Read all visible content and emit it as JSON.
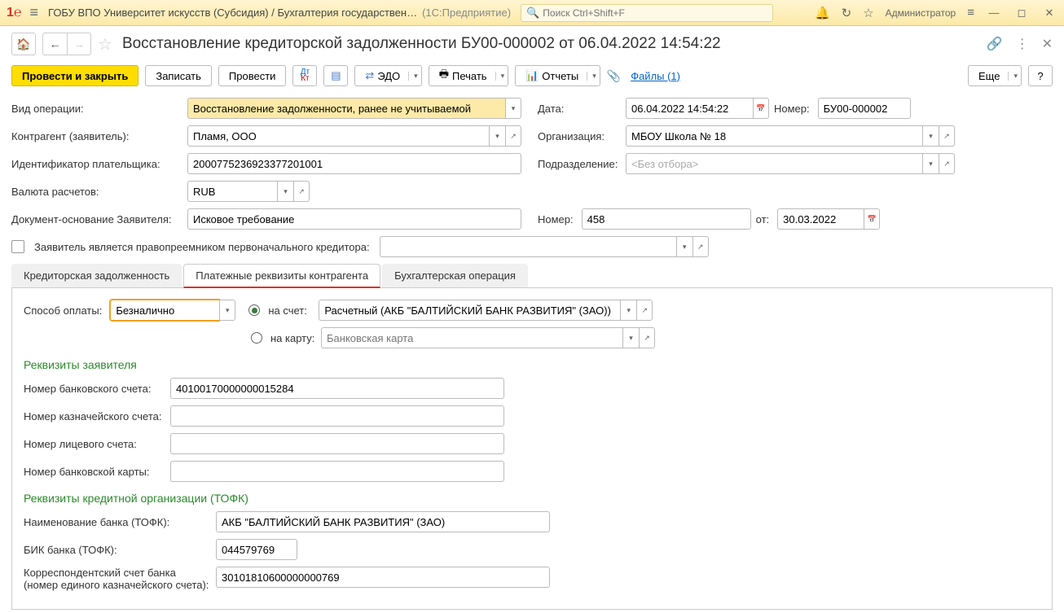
{
  "titlebar": {
    "title": "ГОБУ ВПО Университет искусств (Субсидия) / Бухгалтерия государствен…",
    "suffix": "(1С:Предприятие)",
    "search_placeholder": "Поиск Ctrl+Shift+F",
    "user": "Администратор"
  },
  "doc": {
    "title": "Восстановление кредиторской задолженности БУ00-000002 от 06.04.2022 14:54:22"
  },
  "toolbar": {
    "post_close": "Провести и закрыть",
    "save": "Записать",
    "post": "Провести",
    "edo": "ЭДО",
    "print": "Печать",
    "reports": "Отчеты",
    "files": "Файлы (1)",
    "more": "Еще"
  },
  "form": {
    "operation_type_label": "Вид операции:",
    "operation_type": "Восстановление задолженности, ранее не учитываемой",
    "date_label": "Дата:",
    "date": "06.04.2022 14:54:22",
    "number_label": "Номер:",
    "number": "БУ00-000002",
    "counterparty_label": "Контрагент (заявитель):",
    "counterparty": "Пламя, ООО",
    "org_label": "Организация:",
    "org": "МБОУ Школа № 18",
    "payer_id_label": "Идентификатор плательщика:",
    "payer_id": "2000775236923377201001",
    "dept_label": "Подразделение:",
    "dept_placeholder": "<Без отбора>",
    "currency_label": "Валюта расчетов:",
    "currency": "RUB",
    "basis_label": "Документ-основание Заявителя:",
    "basis": "Исковое требование",
    "basis_num_label": "Номер:",
    "basis_num": "458",
    "basis_from": "от:",
    "basis_date": "30.03.2022",
    "successor_label": "Заявитель является правопреемником первоначального кредитора:"
  },
  "tabs": {
    "t1": "Кредиторская задолженность",
    "t2": "Платежные реквизиты контрагента",
    "t3": "Бухгалтерская операция"
  },
  "payment": {
    "method_label": "Способ оплаты:",
    "method": "Безналично",
    "to_account": "на счет:",
    "account": "Расчетный (АКБ \"БАЛТИЙСКИЙ БАНК РАЗВИТИЯ\" (ЗАО))",
    "to_card": "на карту:",
    "card_placeholder": "Банковская карта",
    "applicant_title": "Реквизиты заявителя",
    "bank_acc_label": "Номер банковского счета:",
    "bank_acc": "40100170000000015284",
    "treasury_label": "Номер казначейского счета:",
    "personal_label": "Номер лицевого счета:",
    "card_num_label": "Номер банковской карты:",
    "org_title": "Реквизиты кредитной организации (ТОФК)",
    "bank_name_label": "Наименование банка (ТОФК):",
    "bank_name": "АКБ \"БАЛТИЙСКИЙ БАНК РАЗВИТИЯ\" (ЗАО)",
    "bik_label": "БИК банка (ТОФК):",
    "bik": "044579769",
    "corr_label": "Корреспондентский счет банка (номер единого казначейского счета):",
    "corr": "30101810600000000769"
  }
}
